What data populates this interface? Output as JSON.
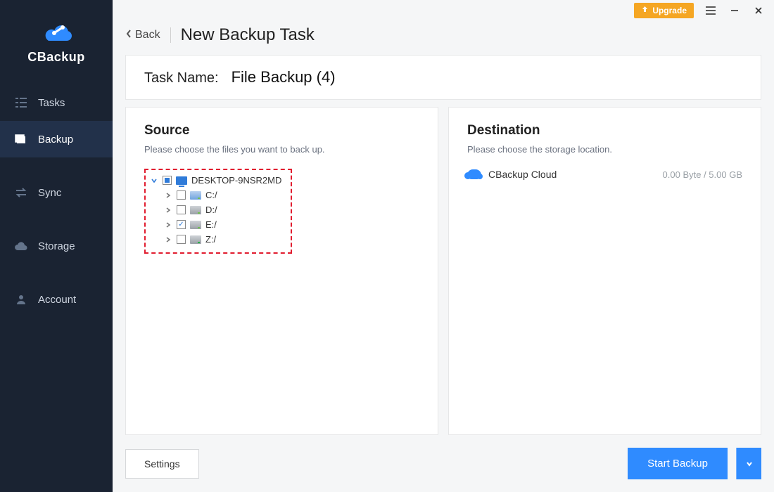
{
  "brand": {
    "name": "CBackup"
  },
  "titlebar": {
    "upgrade_label": "Upgrade"
  },
  "sidebar": {
    "items": [
      {
        "label": "Tasks"
      },
      {
        "label": "Backup"
      },
      {
        "label": "Sync"
      },
      {
        "label": "Storage"
      },
      {
        "label": "Account"
      }
    ]
  },
  "header": {
    "back_label": "Back",
    "title": "New Backup Task"
  },
  "task": {
    "name_label": "Task Name:",
    "name_value": "File Backup (4)"
  },
  "source": {
    "title": "Source",
    "hint": "Please choose the files you want to back up.",
    "root": {
      "label": "DESKTOP-9NSR2MD"
    },
    "drives": [
      {
        "label": "C:/",
        "checked": false,
        "kind": "sys"
      },
      {
        "label": "D:/",
        "checked": false,
        "kind": "hdd"
      },
      {
        "label": "E:/",
        "checked": true,
        "kind": "hdd"
      },
      {
        "label": "Z:/",
        "checked": false,
        "kind": "net"
      }
    ]
  },
  "destination": {
    "title": "Destination",
    "hint": "Please choose the storage location.",
    "target_label": "CBackup Cloud",
    "usage": "0.00 Byte / 5.00 GB"
  },
  "footer": {
    "settings_label": "Settings",
    "start_label": "Start Backup"
  }
}
